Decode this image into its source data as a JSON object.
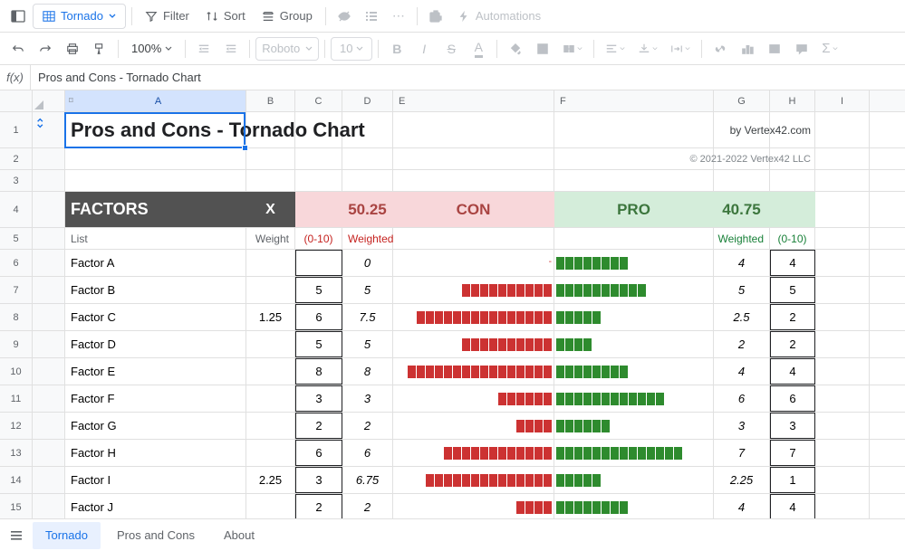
{
  "toolbar": {
    "tab_name": "Tornado",
    "filter": "Filter",
    "sort": "Sort",
    "group": "Group",
    "automations": "Automations",
    "zoom": "100%",
    "font": "Roboto",
    "fontsize": "10"
  },
  "fx": {
    "label": "f(x)",
    "content": "Pros and Cons - Tornado Chart"
  },
  "columns": [
    "A",
    "B",
    "C",
    "D",
    "E",
    "F",
    "G",
    "H",
    "I"
  ],
  "title": "Pros and Cons - Tornado Chart",
  "byline": "by Vertex42.com",
  "copyright": "© 2021-2022 Vertex42 LLC",
  "header": {
    "factors": "FACTORS",
    "x": "X",
    "con_total": "50.25",
    "con": "CON",
    "pro": "PRO",
    "pro_total": "40.75"
  },
  "subheader": {
    "list": "List",
    "weight": "Weight",
    "range_con": "(0-10)",
    "weighted_con": "Weighted",
    "weighted_pro": "Weighted",
    "range_pro": "(0-10)"
  },
  "rows": [
    {
      "n": 6,
      "name": "Factor A",
      "x": "",
      "c": "",
      "dw": "0",
      "con": 0,
      "pro": 4,
      "gw": "4",
      "h": "4"
    },
    {
      "n": 7,
      "name": "Factor B",
      "x": "",
      "c": "5",
      "dw": "5",
      "con": 5,
      "pro": 5,
      "gw": "5",
      "h": "5"
    },
    {
      "n": 8,
      "name": "Factor C",
      "x": "1.25",
      "c": "6",
      "dw": "7.5",
      "con": 7.5,
      "pro": 2.5,
      "gw": "2.5",
      "h": "2"
    },
    {
      "n": 9,
      "name": "Factor D",
      "x": "",
      "c": "5",
      "dw": "5",
      "con": 5,
      "pro": 2,
      "gw": "2",
      "h": "2"
    },
    {
      "n": 10,
      "name": "Factor E",
      "x": "",
      "c": "8",
      "dw": "8",
      "con": 8,
      "pro": 4,
      "gw": "4",
      "h": "4"
    },
    {
      "n": 11,
      "name": "Factor F",
      "x": "",
      "c": "3",
      "dw": "3",
      "con": 3,
      "pro": 6,
      "gw": "6",
      "h": "6"
    },
    {
      "n": 12,
      "name": "Factor G",
      "x": "",
      "c": "2",
      "dw": "2",
      "con": 2,
      "pro": 3,
      "gw": "3",
      "h": "3"
    },
    {
      "n": 13,
      "name": "Factor H",
      "x": "",
      "c": "6",
      "dw": "6",
      "con": 6,
      "pro": 7,
      "gw": "7",
      "h": "7"
    },
    {
      "n": 14,
      "name": "Factor I",
      "x": "2.25",
      "c": "3",
      "dw": "6.75",
      "con": 6.75,
      "pro": 2.25,
      "gw": "2.25",
      "h": "1"
    },
    {
      "n": 15,
      "name": "Factor J",
      "x": "",
      "c": "2",
      "dw": "2",
      "con": 2,
      "pro": 4,
      "gw": "4",
      "h": "4"
    }
  ],
  "sheets": [
    "Tornado",
    "Pros and Cons",
    "About"
  ],
  "chart_data": {
    "type": "bar",
    "title": "Pros and Cons - Tornado Chart",
    "categories": [
      "Factor A",
      "Factor B",
      "Factor C",
      "Factor D",
      "Factor E",
      "Factor F",
      "Factor G",
      "Factor H",
      "Factor I",
      "Factor J"
    ],
    "series": [
      {
        "name": "CON (weighted)",
        "values": [
          0,
          5,
          7.5,
          5,
          8,
          3,
          2,
          6,
          6.75,
          2
        ]
      },
      {
        "name": "PRO (weighted)",
        "values": [
          4,
          5,
          2.5,
          2,
          4,
          6,
          3,
          7,
          2.25,
          4
        ]
      }
    ],
    "totals": {
      "con": 50.25,
      "pro": 40.75
    },
    "xlabel": "",
    "ylabel": "",
    "xlim": [
      -10,
      10
    ]
  }
}
